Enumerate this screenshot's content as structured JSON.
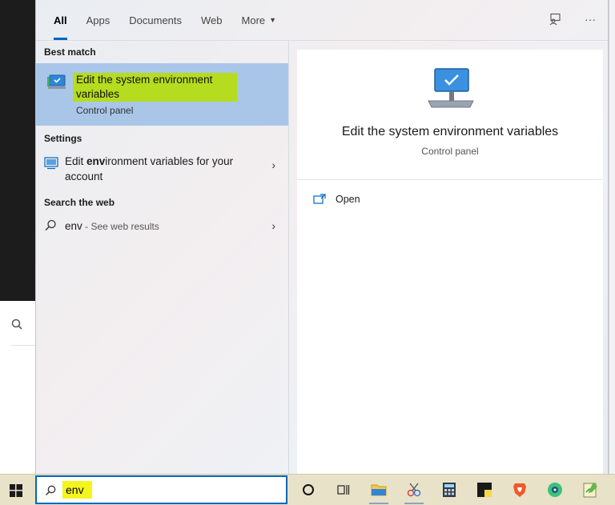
{
  "tabs": [
    {
      "label": "All",
      "active": true
    },
    {
      "label": "Apps",
      "active": false
    },
    {
      "label": "Documents",
      "active": false
    },
    {
      "label": "Web",
      "active": false
    },
    {
      "label": "More",
      "active": false
    }
  ],
  "top_icons": [
    "feedback-icon",
    "more-options-icon"
  ],
  "best_match": {
    "section_label": "Best match",
    "title": "Edit the system environment variables",
    "subtitle": "Control panel",
    "icon": "system-monitor-icon"
  },
  "settings": {
    "section_label": "Settings",
    "item": {
      "text_pre": "Edit ",
      "text_bold": "env",
      "text_post": "ironment variables for your account",
      "icon": "settings-monitor-icon"
    }
  },
  "web": {
    "section_label": "Search the web",
    "query": "env",
    "suffix": " - See web results",
    "icon": "search-icon"
  },
  "detail": {
    "title": "Edit the system environment variables",
    "subtitle": "Control panel",
    "actions": [
      {
        "label": "Open",
        "icon": "open-icon"
      }
    ]
  },
  "taskbar": {
    "search_value": "env",
    "apps": [
      "cortana-icon",
      "task-view-icon",
      "file-explorer-icon",
      "snipping-tool-icon",
      "calculator-icon",
      "sticky-notes-icon",
      "brave-browser-icon",
      "app-icon",
      "notepad-icon"
    ]
  },
  "colors": {
    "accent": "#0067c0",
    "selection": "#a9c6e8",
    "highlight": "#b6dc1f",
    "taskbar": "#e8e2c9"
  }
}
